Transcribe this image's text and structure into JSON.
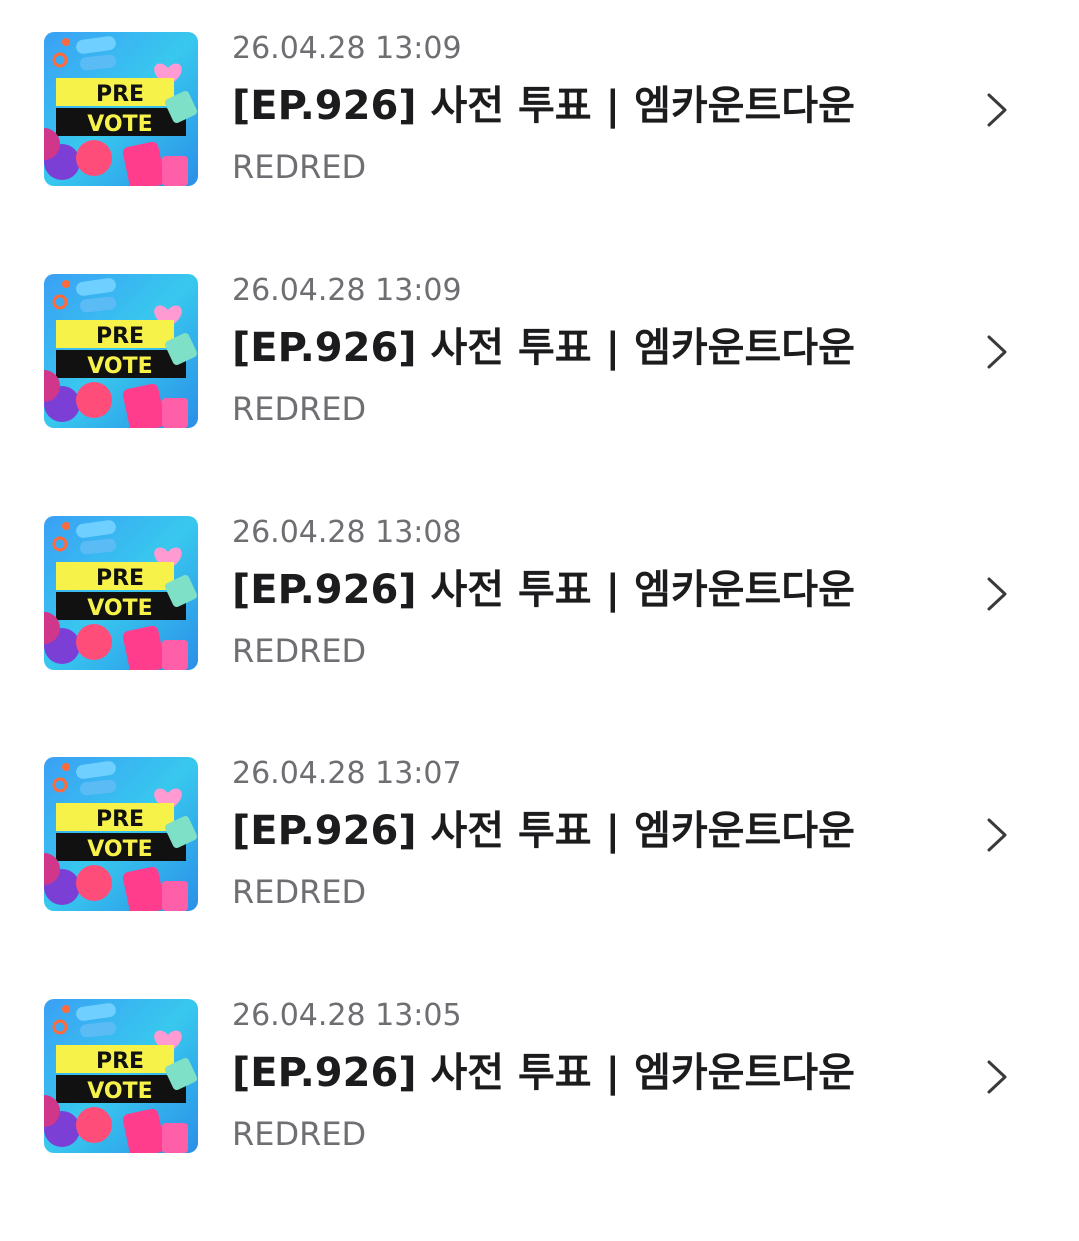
{
  "colors": {
    "background": "#ffffff",
    "title": "#1c1c1e",
    "secondary": "#6e6e73",
    "chevron": "#3a3a3c"
  },
  "thumbnail": {
    "line1": "PRE",
    "line2": "VOTE"
  },
  "items": [
    {
      "date": "26.04.28 13:09",
      "title": "[EP.926] 사전 투표 | 엠카운트다운",
      "artist": "REDRED",
      "chevron": "chevron-right-icon"
    },
    {
      "date": "26.04.28 13:09",
      "title": "[EP.926] 사전 투표 | 엠카운트다운",
      "artist": "REDRED",
      "chevron": "chevron-right-icon"
    },
    {
      "date": "26.04.28 13:08",
      "title": "[EP.926] 사전 투표 | 엠카운트다운",
      "artist": "REDRED",
      "chevron": "chevron-right-icon"
    },
    {
      "date": "26.04.28 13:07",
      "title": "[EP.926] 사전 투표 | 엠카운트다운",
      "artist": "REDRED",
      "chevron": "chevron-right-icon"
    },
    {
      "date": "26.04.28 13:05",
      "title": "[EP.926] 사전 투표 | 엠카운트다운",
      "artist": "REDRED",
      "chevron": "chevron-right-icon"
    }
  ]
}
